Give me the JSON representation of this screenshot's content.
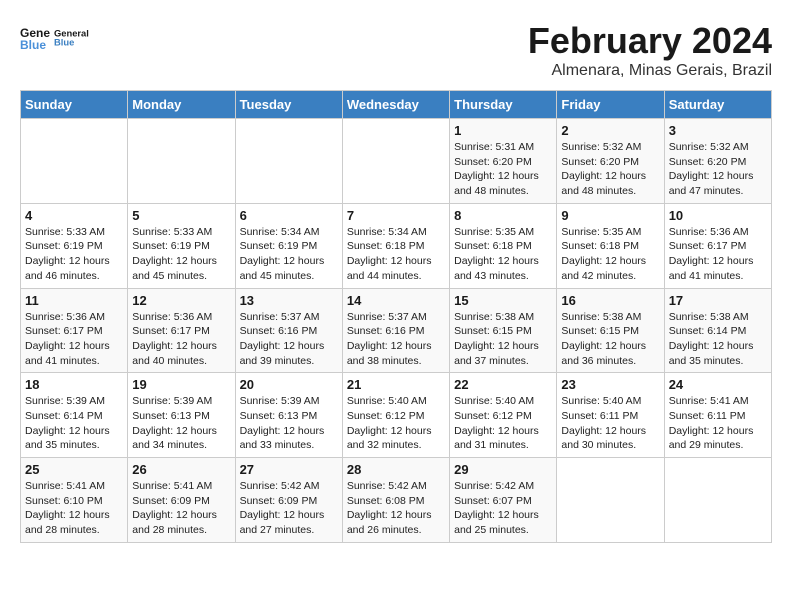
{
  "header": {
    "logo_line1": "General",
    "logo_line2": "Blue",
    "title": "February 2024",
    "subtitle": "Almenara, Minas Gerais, Brazil"
  },
  "days_of_week": [
    "Sunday",
    "Monday",
    "Tuesday",
    "Wednesday",
    "Thursday",
    "Friday",
    "Saturday"
  ],
  "weeks": [
    [
      {
        "day": "",
        "info": ""
      },
      {
        "day": "",
        "info": ""
      },
      {
        "day": "",
        "info": ""
      },
      {
        "day": "",
        "info": ""
      },
      {
        "day": "1",
        "info": "Sunrise: 5:31 AM\nSunset: 6:20 PM\nDaylight: 12 hours\nand 48 minutes."
      },
      {
        "day": "2",
        "info": "Sunrise: 5:32 AM\nSunset: 6:20 PM\nDaylight: 12 hours\nand 48 minutes."
      },
      {
        "day": "3",
        "info": "Sunrise: 5:32 AM\nSunset: 6:20 PM\nDaylight: 12 hours\nand 47 minutes."
      }
    ],
    [
      {
        "day": "4",
        "info": "Sunrise: 5:33 AM\nSunset: 6:19 PM\nDaylight: 12 hours\nand 46 minutes."
      },
      {
        "day": "5",
        "info": "Sunrise: 5:33 AM\nSunset: 6:19 PM\nDaylight: 12 hours\nand 45 minutes."
      },
      {
        "day": "6",
        "info": "Sunrise: 5:34 AM\nSunset: 6:19 PM\nDaylight: 12 hours\nand 45 minutes."
      },
      {
        "day": "7",
        "info": "Sunrise: 5:34 AM\nSunset: 6:18 PM\nDaylight: 12 hours\nand 44 minutes."
      },
      {
        "day": "8",
        "info": "Sunrise: 5:35 AM\nSunset: 6:18 PM\nDaylight: 12 hours\nand 43 minutes."
      },
      {
        "day": "9",
        "info": "Sunrise: 5:35 AM\nSunset: 6:18 PM\nDaylight: 12 hours\nand 42 minutes."
      },
      {
        "day": "10",
        "info": "Sunrise: 5:36 AM\nSunset: 6:17 PM\nDaylight: 12 hours\nand 41 minutes."
      }
    ],
    [
      {
        "day": "11",
        "info": "Sunrise: 5:36 AM\nSunset: 6:17 PM\nDaylight: 12 hours\nand 41 minutes."
      },
      {
        "day": "12",
        "info": "Sunrise: 5:36 AM\nSunset: 6:17 PM\nDaylight: 12 hours\nand 40 minutes."
      },
      {
        "day": "13",
        "info": "Sunrise: 5:37 AM\nSunset: 6:16 PM\nDaylight: 12 hours\nand 39 minutes."
      },
      {
        "day": "14",
        "info": "Sunrise: 5:37 AM\nSunset: 6:16 PM\nDaylight: 12 hours\nand 38 minutes."
      },
      {
        "day": "15",
        "info": "Sunrise: 5:38 AM\nSunset: 6:15 PM\nDaylight: 12 hours\nand 37 minutes."
      },
      {
        "day": "16",
        "info": "Sunrise: 5:38 AM\nSunset: 6:15 PM\nDaylight: 12 hours\nand 36 minutes."
      },
      {
        "day": "17",
        "info": "Sunrise: 5:38 AM\nSunset: 6:14 PM\nDaylight: 12 hours\nand 35 minutes."
      }
    ],
    [
      {
        "day": "18",
        "info": "Sunrise: 5:39 AM\nSunset: 6:14 PM\nDaylight: 12 hours\nand 35 minutes."
      },
      {
        "day": "19",
        "info": "Sunrise: 5:39 AM\nSunset: 6:13 PM\nDaylight: 12 hours\nand 34 minutes."
      },
      {
        "day": "20",
        "info": "Sunrise: 5:39 AM\nSunset: 6:13 PM\nDaylight: 12 hours\nand 33 minutes."
      },
      {
        "day": "21",
        "info": "Sunrise: 5:40 AM\nSunset: 6:12 PM\nDaylight: 12 hours\nand 32 minutes."
      },
      {
        "day": "22",
        "info": "Sunrise: 5:40 AM\nSunset: 6:12 PM\nDaylight: 12 hours\nand 31 minutes."
      },
      {
        "day": "23",
        "info": "Sunrise: 5:40 AM\nSunset: 6:11 PM\nDaylight: 12 hours\nand 30 minutes."
      },
      {
        "day": "24",
        "info": "Sunrise: 5:41 AM\nSunset: 6:11 PM\nDaylight: 12 hours\nand 29 minutes."
      }
    ],
    [
      {
        "day": "25",
        "info": "Sunrise: 5:41 AM\nSunset: 6:10 PM\nDaylight: 12 hours\nand 28 minutes."
      },
      {
        "day": "26",
        "info": "Sunrise: 5:41 AM\nSunset: 6:09 PM\nDaylight: 12 hours\nand 28 minutes."
      },
      {
        "day": "27",
        "info": "Sunrise: 5:42 AM\nSunset: 6:09 PM\nDaylight: 12 hours\nand 27 minutes."
      },
      {
        "day": "28",
        "info": "Sunrise: 5:42 AM\nSunset: 6:08 PM\nDaylight: 12 hours\nand 26 minutes."
      },
      {
        "day": "29",
        "info": "Sunrise: 5:42 AM\nSunset: 6:07 PM\nDaylight: 12 hours\nand 25 minutes."
      },
      {
        "day": "",
        "info": ""
      },
      {
        "day": "",
        "info": ""
      }
    ]
  ]
}
